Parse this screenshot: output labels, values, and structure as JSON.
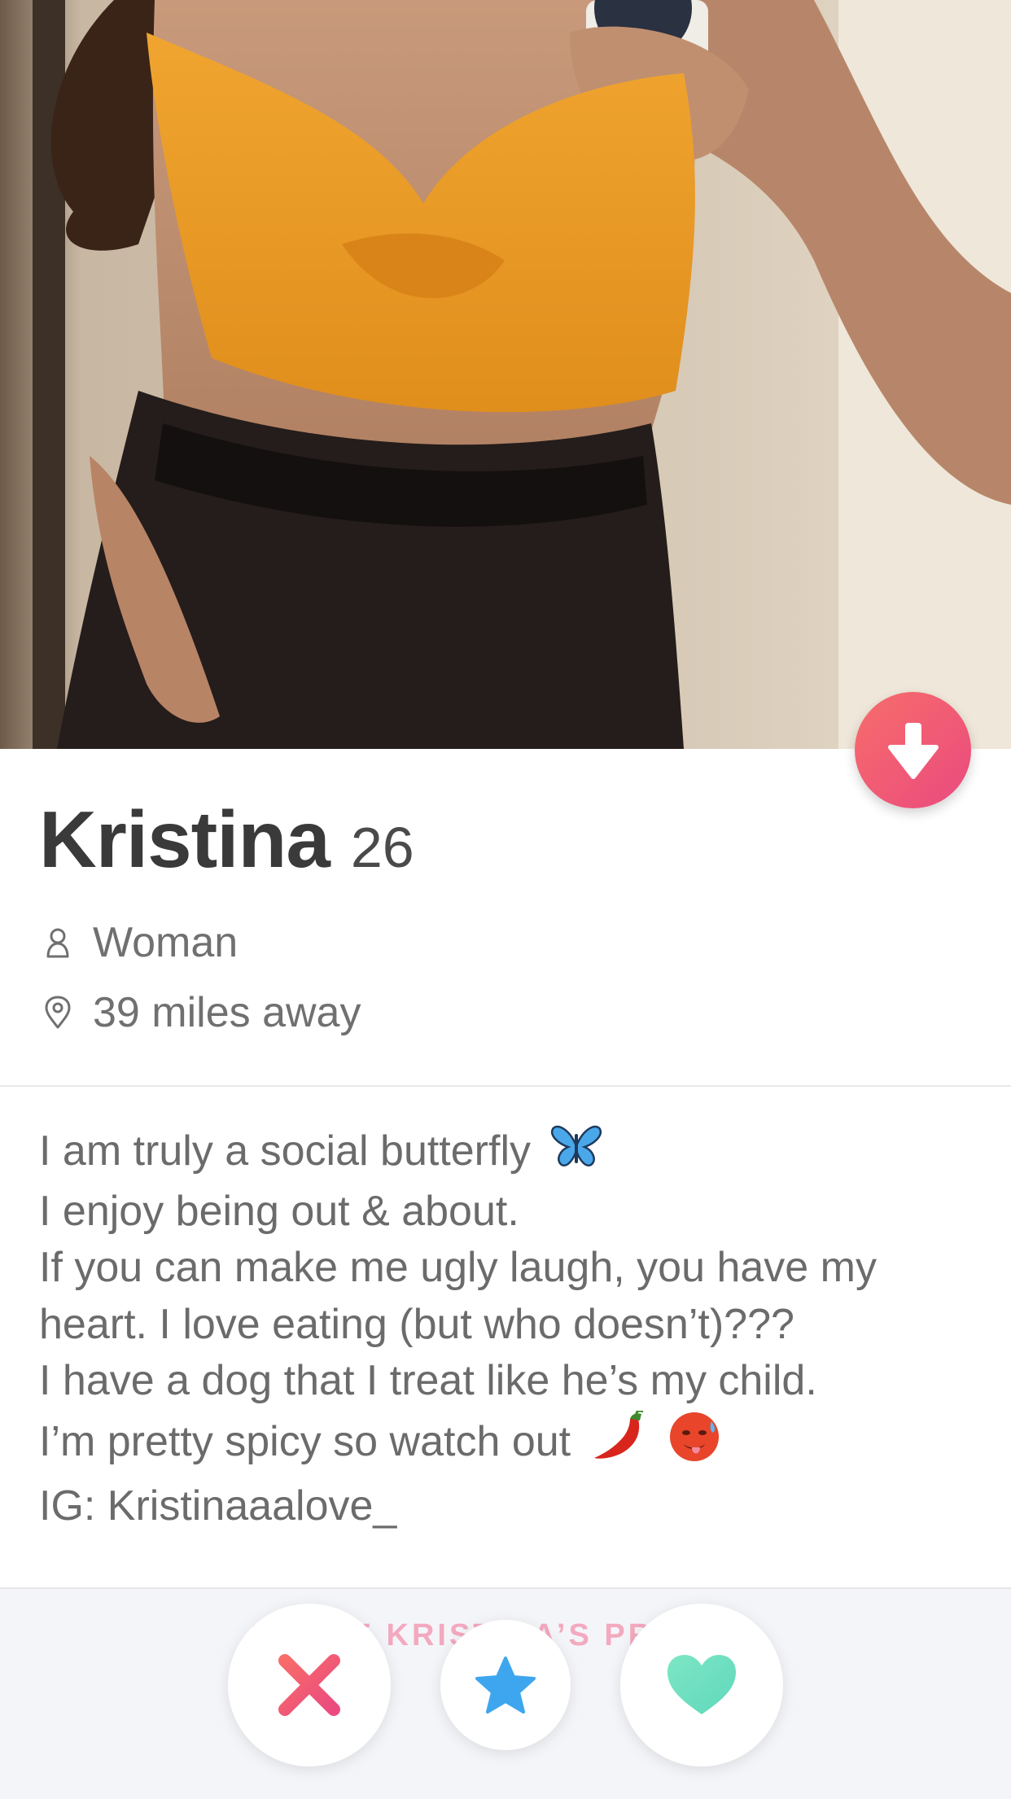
{
  "profile": {
    "name": "Kristina",
    "age": "26",
    "gender": "Woman",
    "distance": "39 miles away",
    "bio_lines": [
      "I am truly a social butterfly",
      "I enjoy being out & about.",
      "If you can make me ugly laugh, you have my",
      "heart. I love eating (but who doesn’t)???",
      "I have a dog that I treat like he’s my child.",
      "I’m pretty spicy so watch out",
      "IG: Kristinaaalove_"
    ],
    "bio_emojis": [
      "butterfly-emoji",
      "hot-pepper-emoji",
      "hot-face-emoji"
    ]
  },
  "footer": {
    "share_label": "SHARE KRISTINA’S PROFILE"
  },
  "icons": {
    "collapse": "arrow-down-icon",
    "gender": "person-icon",
    "distance": "location-pin-icon",
    "nope": "x-icon",
    "super_like": "star-icon",
    "like": "heart-icon"
  },
  "colors": {
    "brand_gradient_start": "#f76d6a",
    "brand_gradient_end": "#ea4a7f",
    "nope": "#f0586b",
    "super_like": "#3ea6ef",
    "like": "#6fe0bf"
  }
}
